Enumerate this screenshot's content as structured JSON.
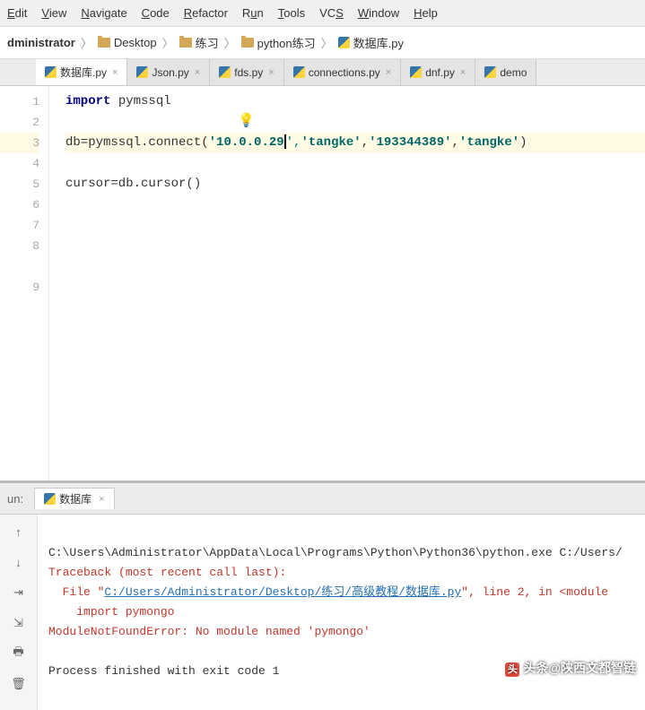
{
  "menu": {
    "edit": "Edit",
    "view": "View",
    "navigate": "Navigate",
    "code": "Code",
    "refactor": "Refactor",
    "run": "Run",
    "tools": "Tools",
    "vcs": "VCS",
    "window": "Window",
    "help": "Help"
  },
  "breadcrumb": {
    "item0": "dministrator",
    "item1": "Desktop",
    "item2": "练习",
    "item3": "python练习",
    "item4": "数据库.py"
  },
  "tabs": [
    {
      "label": "数据库.py",
      "active": true
    },
    {
      "label": "Json.py",
      "active": false
    },
    {
      "label": "fds.py",
      "active": false
    },
    {
      "label": "connections.py",
      "active": false
    },
    {
      "label": "dnf.py",
      "active": false
    },
    {
      "label": "demo",
      "active": false
    }
  ],
  "gutter": [
    "1",
    "2",
    "3",
    "4",
    "5",
    "6",
    "7",
    "8",
    "9"
  ],
  "code": {
    "l1_kw": "import",
    "l1_rest": " pymssql",
    "l3_a": "db=pymssql.connect(",
    "l3_s1": "'10.0.0.29",
    "l3_c1": "',",
    "l3_s2": "'tangke'",
    "l3_c2": ",",
    "l3_s3": "'193344389'",
    "l3_c3": ",",
    "l3_s4": "'tangke'",
    "l3_end": ")",
    "l5": "cursor=db.cursor()"
  },
  "run": {
    "label": "un:",
    "tab": "数据库",
    "line1": "C:\\Users\\Administrator\\AppData\\Local\\Programs\\Python\\Python36\\python.exe C:/Users/",
    "line2": "Traceback (most recent call last):",
    "line3a": "  File \"",
    "line3link": "C:/Users/Administrator/Desktop/练习/高级教程/数据库.py",
    "line3b": "\", line 2, in <module",
    "line4": "    import pymongo",
    "line5": "ModuleNotFoundError: No module named 'pymongo'",
    "line7": "Process finished with exit code 1"
  },
  "watermark": "头条@陕西文都智链"
}
